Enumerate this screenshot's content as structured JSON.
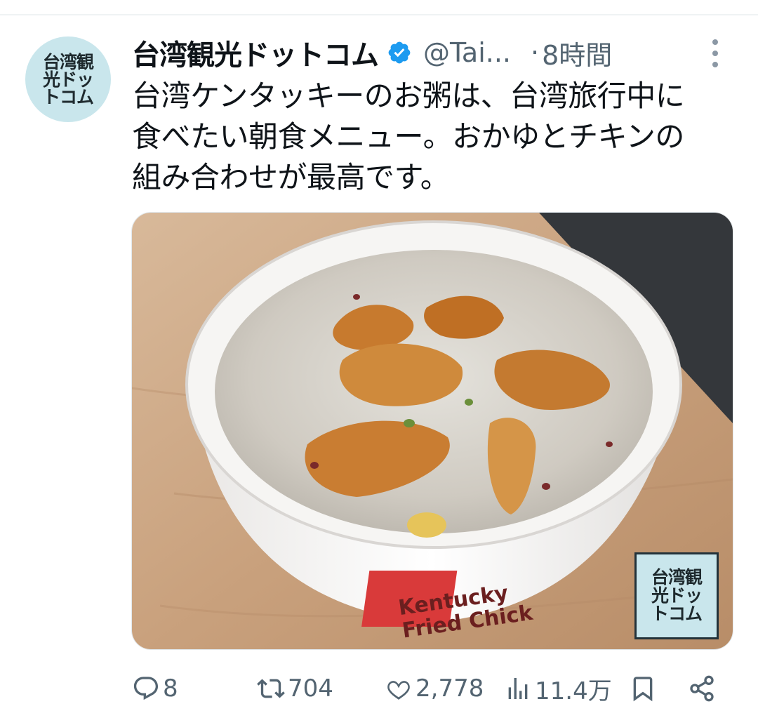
{
  "tweet": {
    "author": {
      "display_name": "台湾観光ドットコム",
      "handle": "@Tai...",
      "avatar_text": [
        "台湾観",
        "光ドッ",
        "トコム"
      ],
      "verified": true
    },
    "separator": "·",
    "timestamp": "8時間",
    "text_lines": [
      "台湾ケンタッキーのお粥は、台湾旅行中に",
      "食べたい朝食メニュー。おかゆとチキンの",
      "組み合わせが最高です。"
    ],
    "media": {
      "watermark_text": [
        "台湾観",
        "光ドッ",
        "トコム"
      ],
      "cup_print": "Kentucky Fried Chicken"
    },
    "actions": {
      "replies": "8",
      "retweets": "704",
      "likes": "2,778",
      "views": "11.4万"
    }
  },
  "icons": [
    "verified-badge-icon",
    "more-options-icon",
    "reply-icon",
    "retweet-icon",
    "like-icon",
    "views-icon",
    "bookmark-icon",
    "share-icon"
  ],
  "colors": {
    "verified": "#1d9bf0",
    "secondary_text": "#536471",
    "primary_text": "#0f1419",
    "avatar_bg": "#c9e6ec"
  }
}
